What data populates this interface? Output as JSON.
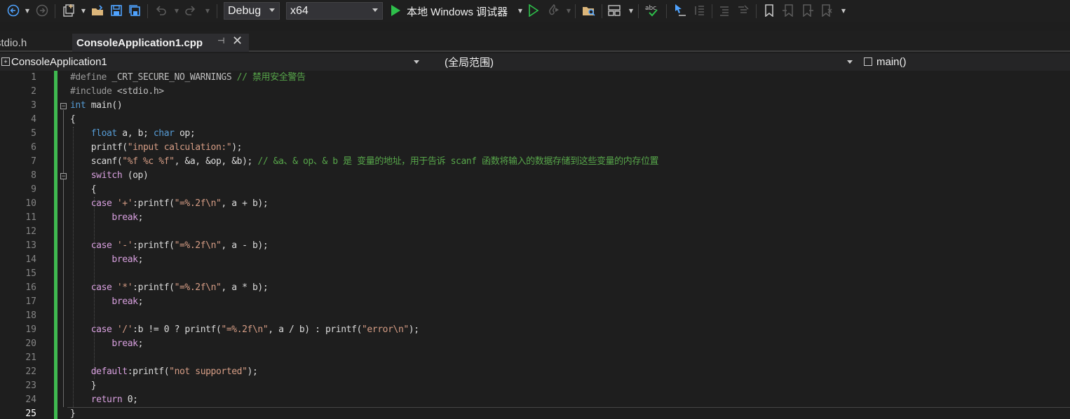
{
  "toolbar": {
    "icons": [
      "back-icon",
      "forward-icon",
      "new-project-icon",
      "open-file-icon",
      "save-icon",
      "save-all-icon",
      "undo-icon",
      "redo-icon",
      "start-debugging-icon",
      "start-without-debugging-icon",
      "hot-reload-icon",
      "find-in-files-icon",
      "layout-icon",
      "spell-check-icon",
      "select-icon",
      "comment-icon",
      "uncomment-icon",
      "bookmark-icon"
    ],
    "configuration": "Debug",
    "platform": "x64",
    "run_label": "本地 Windows 调试器"
  },
  "tabs": [
    {
      "label": "stdio.h",
      "active": false
    },
    {
      "label": "ConsoleApplication1.cpp",
      "active": true
    }
  ],
  "navbar": {
    "project": "ConsoleApplication1",
    "scope": "(全局范围)",
    "function": "main()"
  },
  "editor": {
    "current_line": 25,
    "lines": [
      {
        "n": "1",
        "text": "#define _CRT_SECURE_NO_WARNINGS // 禁用安全警告"
      },
      {
        "n": "2",
        "text": "#include <stdio.h>"
      },
      {
        "n": "3",
        "text": "int main()"
      },
      {
        "n": "4",
        "text": "{"
      },
      {
        "n": "5",
        "text": "    float a, b; char op;"
      },
      {
        "n": "6",
        "text": "    printf(\"input calculation:\");"
      },
      {
        "n": "7",
        "text": "    scanf(\"%f %c %f\", &a, &op, &b); // &a、& op、& b 是 变量的地址，用于告诉 scanf 函数将输入的数据存储到这些变量的内存位置"
      },
      {
        "n": "8",
        "text": "    switch (op)"
      },
      {
        "n": "9",
        "text": "    {"
      },
      {
        "n": "10",
        "text": "    case '+':printf(\"=%.2f\\n\", a + b);"
      },
      {
        "n": "11",
        "text": "        break;"
      },
      {
        "n": "12",
        "text": ""
      },
      {
        "n": "13",
        "text": "    case '-':printf(\"=%.2f\\n\", a - b);"
      },
      {
        "n": "14",
        "text": "        break;"
      },
      {
        "n": "15",
        "text": ""
      },
      {
        "n": "16",
        "text": "    case '*':printf(\"=%.2f\\n\", a * b);"
      },
      {
        "n": "17",
        "text": "        break;"
      },
      {
        "n": "18",
        "text": ""
      },
      {
        "n": "19",
        "text": "    case '/':b != 0 ? printf(\"=%.2f\\n\", a / b) : printf(\"error\\n\");"
      },
      {
        "n": "20",
        "text": "        break;"
      },
      {
        "n": "21",
        "text": ""
      },
      {
        "n": "22",
        "text": "    default:printf(\"not supported\");"
      },
      {
        "n": "23",
        "text": "    }"
      },
      {
        "n": "24",
        "text": "    return 0;"
      },
      {
        "n": "25",
        "text": "}"
      }
    ]
  }
}
